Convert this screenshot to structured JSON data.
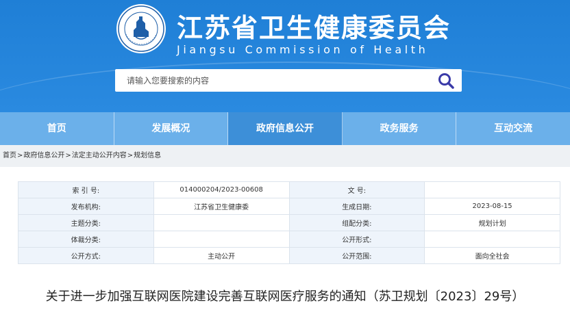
{
  "header": {
    "title": "江苏省卫生健康委员会",
    "subtitle": "Jiangsu Commission of Health",
    "emblem_text": "Jiangsu Commission of Health"
  },
  "search": {
    "placeholder": "请输入您要搜索的内容"
  },
  "nav": {
    "items": [
      "首页",
      "发展概况",
      "政府信息公开",
      "政务服务",
      "互动交流"
    ]
  },
  "breadcrumb": {
    "items": [
      "首页",
      "政府信息公开",
      "法定主动公开内容",
      "规划信息"
    ],
    "separator": ">"
  },
  "info": {
    "rows": [
      {
        "l1": "索 引 号:",
        "v1": "014000204/2023-00608",
        "l2": "文    号:",
        "v2": ""
      },
      {
        "l1": "发布机构:",
        "v1": "江苏省卫生健康委",
        "l2": "生成日期:",
        "v2": "2023-08-15"
      },
      {
        "l1": "主题分类:",
        "v1": "",
        "l2": "组配分类:",
        "v2": "规划计划"
      },
      {
        "l1": "体裁分类:",
        "v1": "",
        "l2": "公开形式:",
        "v2": ""
      },
      {
        "l1": "公开方式:",
        "v1": "主动公开",
        "l2": "公开范围:",
        "v2": "面向全社会"
      }
    ]
  },
  "document": {
    "title": "关于进一步加强互联网医院建设完善互联网医疗服务的通知（苏卫规划〔2023〕29号）"
  },
  "colors": {
    "header_blue": "#1f7fd6",
    "nav_blue": "#6bb0ea",
    "nav_active": "#3d8fd8",
    "label_bg": "#eef4fb",
    "crumb_bg": "#eef1f4"
  }
}
